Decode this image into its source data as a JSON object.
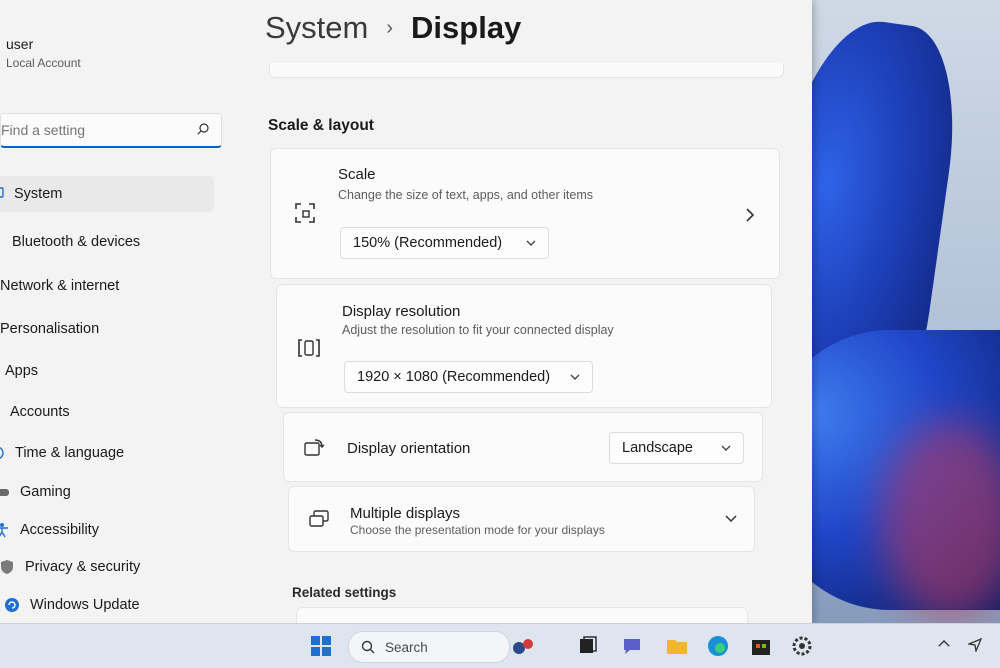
{
  "user": {
    "name": "user",
    "account_type": "Local Account"
  },
  "search": {
    "placeholder": "Find a setting",
    "value": ""
  },
  "nav": {
    "items": [
      {
        "label": "System",
        "icon": "monitor-icon"
      },
      {
        "label": "Bluetooth & devices",
        "icon": "bluetooth-icon"
      },
      {
        "label": "Network & internet",
        "icon": "wifi-icon"
      },
      {
        "label": "Personalisation",
        "icon": "brush-icon"
      },
      {
        "label": "Apps",
        "icon": "apps-icon"
      },
      {
        "label": "Accounts",
        "icon": "person-icon"
      },
      {
        "label": "Time & language",
        "icon": "globe-clock-icon"
      },
      {
        "label": "Gaming",
        "icon": "gamepad-icon"
      },
      {
        "label": "Accessibility",
        "icon": "accessibility-icon"
      },
      {
        "label": "Privacy & security",
        "icon": "shield-icon"
      },
      {
        "label": "Windows Update",
        "icon": "update-icon"
      }
    ],
    "selected": "System"
  },
  "breadcrumb": {
    "parent": "System",
    "separator": "›",
    "current": "Display"
  },
  "section": {
    "title": "Scale & layout"
  },
  "scale": {
    "title": "Scale",
    "description": "Change the size of text, apps, and other items",
    "value": "150% (Recommended)"
  },
  "resolution": {
    "title": "Display resolution",
    "description": "Adjust the resolution to fit your connected display",
    "value": "1920 × 1080 (Recommended)"
  },
  "orientation": {
    "title": "Display orientation",
    "value": "Landscape"
  },
  "multiple_displays": {
    "title": "Multiple displays",
    "description": "Choose the presentation mode for your displays"
  },
  "related": {
    "title": "Related settings"
  },
  "taskbar": {
    "search_label": "Search",
    "icons": [
      "start-icon",
      "search-icon",
      "widgets-icon",
      "task-view-icon",
      "chat-icon",
      "file-explorer-icon",
      "edge-icon",
      "store-icon",
      "settings-icon"
    ]
  },
  "colors": {
    "accent": "#0067c0",
    "window_bg": "#f3f3f3",
    "card_bg": "#fbfbfb"
  }
}
